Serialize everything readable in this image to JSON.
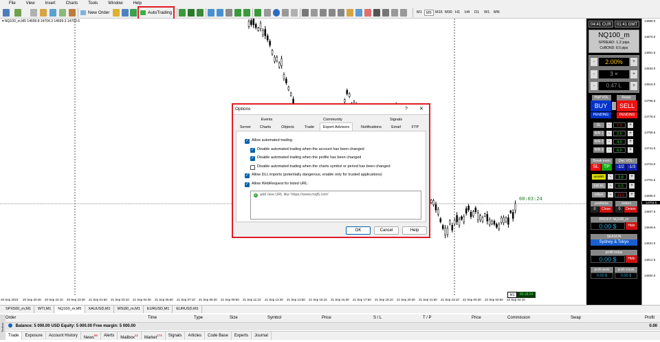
{
  "menu": {
    "items": [
      "File",
      "View",
      "Insert",
      "Charts",
      "Tools",
      "Window",
      "Help"
    ]
  },
  "toolbar": {
    "new_order": "New Order",
    "autotrading": "AutoTrading",
    "timeframes": [
      "M1",
      "M5",
      "M15",
      "M30",
      "H1",
      "H4",
      "D1",
      "W1",
      "MN"
    ],
    "active_timeframe": "M5"
  },
  "chart": {
    "header": "▾ NQ100_m,M5  14699.8 14704.3 14699.3 14703.6",
    "timer": "00:03:24",
    "timeframe_badge": "H1",
    "timeframe_timer": "00:18:24",
    "current_price": "14703.6",
    "price_ticks": [
      "14888.0",
      "14870.0",
      "14851.5",
      "14833.0",
      "14815.0",
      "14796.5",
      "14778.0",
      "14759.5",
      "14741.5",
      "14723.0",
      "14704.5",
      "14686.0",
      "14667.5",
      "14649.5",
      "14631.0",
      "14612.5",
      "14594.0"
    ],
    "time_ticks": [
      "20 Sep 2023",
      "20 Sep 20:45",
      "20 Sep 22:10",
      "20 Sep 23:30",
      "21 Sep 01:50",
      "21 Sep 03:10",
      "21 Sep 04:30",
      "21 Sep 05:50",
      "21 Sep 07:10",
      "21 Sep 08:30",
      "21 Sep 09:50",
      "21 Sep 11:10",
      "21 Sep 12:30",
      "21 Sep 13:50",
      "21 Sep 15:10",
      "21 Sep 16:30",
      "21 Sep 17:50",
      "21 Sep 19:10",
      "21 Sep 20:30",
      "21 Sep 21:50",
      "21 Sep 23:10",
      "22 Sep 00:30",
      "22 Sep 02:50",
      "22 Sep 04:10"
    ]
  },
  "panel": {
    "cur_time": "04:41 CUR",
    "gmt_time": "01:41 GMT",
    "symbol": "NQ100_m",
    "spread": "SPREAD: 1.2  pips",
    "cobond": "CoBOND: 8.5  pips",
    "risk": "2.00%",
    "mult": "3 ×",
    "lots": "0.47 L",
    "half_vol": "Half VOL",
    "reset": "Reset",
    "buy": "BUY",
    "sell": "SELL",
    "pending_left": "PENDING",
    "pending_right": "PENDING",
    "sl_label": "SL",
    "sl_val": "7.0",
    "rr1_label": "R/R 1",
    "rr1_val": "2.0",
    "rr2_label": "R/R 2",
    "rr2_val": "4.0",
    "rr3_label": "R/R 3",
    "rr3_val": "6.0",
    "break_even": "Break even",
    "dec_vol": "Dec VOL-",
    "sl_btn": "SL",
    "tp_btn": "TP",
    "half1": "-1/2",
    "third1": "-1/3",
    "autobr": "autoBR",
    "autobr_val": "3.8",
    "trailsl": "trail SL",
    "trailsl_val": "5.5",
    "offset": "Offset",
    "offset_val": "21.0",
    "positions": "positions",
    "orders": "orders",
    "pos_count": "0",
    "close": "Close",
    "ord_count": "0",
    "delete": "Delete",
    "profit_label": "PROFIT NQ100_m",
    "profit_val": "0.00  $",
    "hide1": "Hide",
    "season_label": "SEASON",
    "season_val": "Sydney & Tokyo",
    "profit_today": "profit today",
    "profit_today_val": "0.00  $",
    "hide2": "Hide",
    "profit_week": "profit week",
    "profit_month": "profit mount",
    "week_val": "0.00  $",
    "month_val": "0.00  $"
  },
  "symbol_tabs": [
    "SPX500_m,M1",
    "WTI,M1",
    "NQ100_m,M5",
    "XAUUSD,M1",
    "WSt30_m,M1",
    "EURUSD,M1",
    "EURUSD,M1"
  ],
  "active_symbol_tab": "NQ100_m,M5",
  "terminal": {
    "columns": [
      "Order",
      "Time",
      "Type",
      "Size",
      "Symbol",
      "Price",
      "S / L",
      "T / P",
      "Price",
      "Commission",
      "Swap",
      "Profit"
    ],
    "balance": "Balance: 5 000.00 USD  Equity: 5 000.00  Free margin: 5 000.00",
    "balance_profit": "0.00",
    "tabs": [
      "Trade",
      "Exposure",
      "Account History",
      "News",
      "Alerts",
      "Mailbox",
      "Market",
      "Signals",
      "Articles",
      "Code Base",
      "Experts",
      "Journal"
    ],
    "tab_badges": {
      "News": "99",
      "Mailbox": "22",
      "Market": "174"
    },
    "side_label": "Toolbox"
  },
  "dialog": {
    "title": "Options",
    "help": "?",
    "close": "✕",
    "tabs_row1": [
      "Events",
      "Community",
      "Signals"
    ],
    "tabs_row2": [
      "Server",
      "Charts",
      "Objects",
      "Trade",
      "Expert Advisors",
      "Notifications",
      "Email",
      "FTP"
    ],
    "active_tab": "Expert Advisors",
    "options": [
      {
        "label": "Allow automated trading",
        "checked": true
      },
      {
        "label": "Disable automated trading when the account has been changed",
        "checked": true
      },
      {
        "label": "Disable automated trading when the profile has been changed",
        "checked": true
      },
      {
        "label": "Disable automated trading when the charts symbol or period has been changed",
        "checked": false
      },
      {
        "label": "Allow DLL imports (potentially dangerous, enable only for trusted applications)",
        "checked": true
      },
      {
        "label": "Allow WebRequest for listed URL:",
        "checked": true
      }
    ],
    "url_placeholder": "add new URL like 'https://www.mql5.com'",
    "ok": "OK",
    "cancel": "Cancel",
    "help_btn": "Help"
  },
  "colors": {
    "highlight": "#e01b24",
    "panel_bg": "#000000",
    "buy": "#0033cc",
    "sell": "#ee1111"
  }
}
